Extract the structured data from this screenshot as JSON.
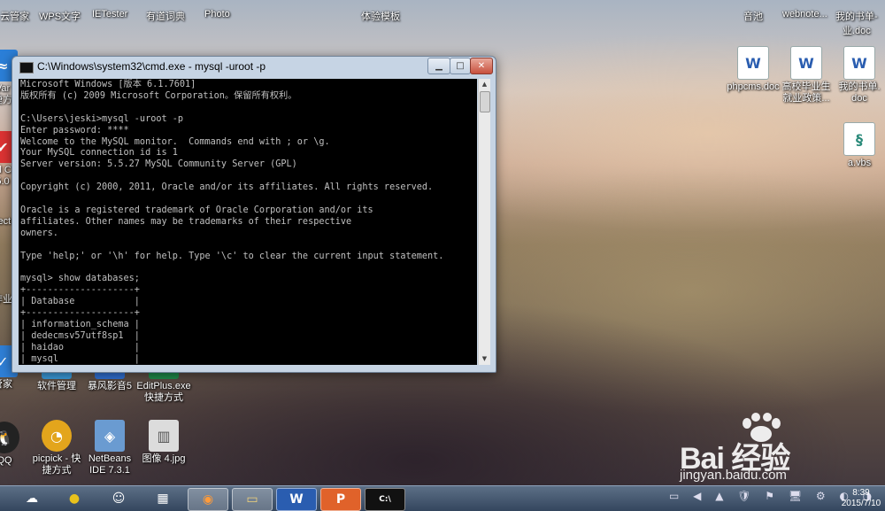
{
  "desktop": {
    "top_labels": [
      "云管家",
      "WPS文字",
      "IETester",
      "有道词典",
      "Photo",
      "体验模板",
      "音池",
      "webnote...",
      "我的书单-\n业.doc"
    ],
    "left_cut_labels": [
      "Var\n捷方",
      "al C\n5.0",
      "rect",
      "作业",
      "",
      "管家",
      "QQ"
    ],
    "left_icons": [
      {
        "label": "软件管理",
        "icon": "apps-icon",
        "color": "#3a9ad9"
      },
      {
        "label": "暴风影音5",
        "icon": "media-player-icon",
        "color": "#2f6fd1"
      },
      {
        "label": "EditPlus.exe\n快捷方式",
        "icon": "editplus-icon",
        "color": "#1e8a4a"
      },
      {
        "label": "picpick - 快\n捷方式",
        "icon": "picpick-icon",
        "color": "#e3a51c"
      },
      {
        "label": "NetBeans\nIDE 7.3.1",
        "icon": "netbeans-icon",
        "color": "#6a9bd1"
      },
      {
        "label": "图像 4.jpg",
        "icon": "image-file-icon",
        "color": "#dcdcdc"
      }
    ],
    "right_icons": [
      {
        "label": "phpcms.doc",
        "icon": "word-doc-icon"
      },
      {
        "label": "高校毕业生\n就业政策...",
        "icon": "word-doc-icon"
      },
      {
        "label": "我的书单.\ndoc",
        "icon": "word-doc-icon"
      },
      {
        "label": "a.vbs",
        "icon": "vbs-script-icon"
      }
    ]
  },
  "cmd": {
    "title": "C:\\Windows\\system32\\cmd.exe - mysql  -uroot -p",
    "min_glyph": "▁",
    "max_glyph": "□",
    "close_glyph": "✕",
    "lines": [
      "Microsoft Windows [版本 6.1.7601]",
      "版权所有 (c) 2009 Microsoft Corporation。保留所有权利。",
      "",
      "C:\\Users\\jeski>mysql -uroot -p",
      "Enter password: ****",
      "Welcome to the MySQL monitor.  Commands end with ; or \\g.",
      "Your MySQL connection id is 1",
      "Server version: 5.5.27 MySQL Community Server (GPL)",
      "",
      "Copyright (c) 2000, 2011, Oracle and/or its affiliates. All rights reserved.",
      "",
      "Oracle is a registered trademark of Oracle Corporation and/or its",
      "affiliates. Other names may be trademarks of their respective",
      "owners.",
      "",
      "Type 'help;' or '\\h' for help. Type '\\c' to clear the current input statement.",
      "",
      "mysql> show databases;",
      "+--------------------+",
      "| Database           |",
      "+--------------------+",
      "| information_schema |",
      "| dedecmsv57utf8sp1  |",
      "| haidao             |",
      "| mysql              |"
    ]
  },
  "taskbar": {
    "apps": [
      {
        "name": "baidu-cloud-icon",
        "glyph": "☁",
        "color": "#3a7fd0",
        "active": false
      },
      {
        "name": "browser-icon",
        "glyph": "●",
        "color": "#e9c21c",
        "active": false
      },
      {
        "name": "wangwang-icon",
        "glyph": "☺",
        "color": "#3a90e0",
        "active": false
      },
      {
        "name": "calculator-icon",
        "glyph": "▦",
        "color": "#4a74b0",
        "active": false
      },
      {
        "name": "firefox-icon",
        "glyph": "◉",
        "color": "#e46a1c",
        "active": true
      },
      {
        "name": "file-explorer-icon",
        "glyph": "▭",
        "color": "#e7c66a",
        "active": true
      },
      {
        "name": "wps-writer-icon",
        "glyph": "W",
        "color": "#2a5db0",
        "active": true
      },
      {
        "name": "wps-presentation-icon",
        "glyph": "P",
        "color": "#e0622a",
        "active": true
      },
      {
        "name": "cmd-icon",
        "glyph": "C:\\",
        "color": "#111111",
        "active": true
      }
    ],
    "tray_glyphs": "▭ ◀ ▲ 🛡 ⚑ 🖥 ⚙ ◐ ◑",
    "time": "8:39",
    "date": "2015/7/10"
  },
  "watermark": {
    "main": "Bai 经验",
    "sub": "jingyan.baidu.com"
  }
}
